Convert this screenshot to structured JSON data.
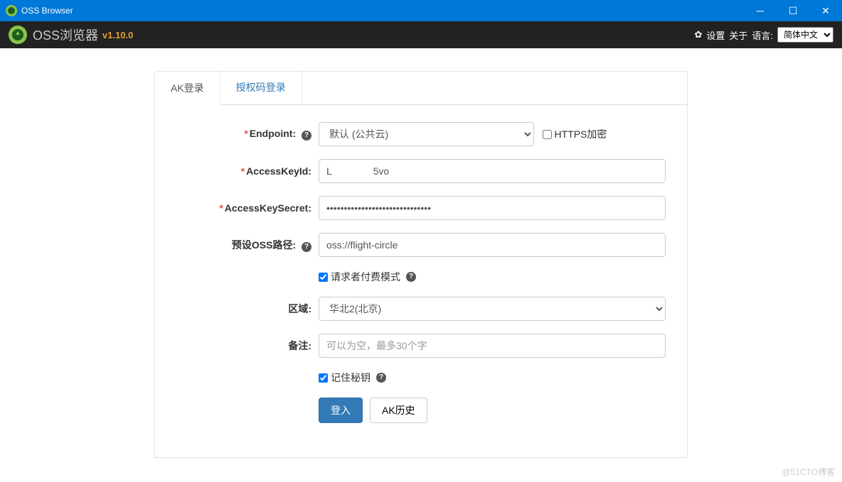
{
  "window": {
    "title": "OSS Browser"
  },
  "header": {
    "app_name": "OSS浏览器",
    "version": "v1.10.0",
    "settings": "设置",
    "about": "关于",
    "lang_label": "语言:",
    "lang_value": "简体中文"
  },
  "tabs": {
    "ak": "AK登录",
    "auth": "授权码登录"
  },
  "form": {
    "endpoint_label": "Endpoint:",
    "endpoint_value": "默认 (公共云)",
    "https_label": "HTTPS加密",
    "akid_label": "AccessKeyId:",
    "akid_value": "L               5vo",
    "aksecret_label": "AccessKeySecret:",
    "aksecret_value": "••••••••••••••••••••••••••••••",
    "preset_label": "预设OSS路径:",
    "preset_value": "oss://flight-circle",
    "requester_pay_label": "请求者付费模式",
    "region_label": "区域:",
    "region_value": "华北2(北京)",
    "remark_label": "备注:",
    "remark_placeholder": "可以为空，最多30个字",
    "remember_label": "记住秘钥",
    "login_btn": "登入",
    "history_btn": "AK历史"
  },
  "watermark": "@51CTO博客"
}
